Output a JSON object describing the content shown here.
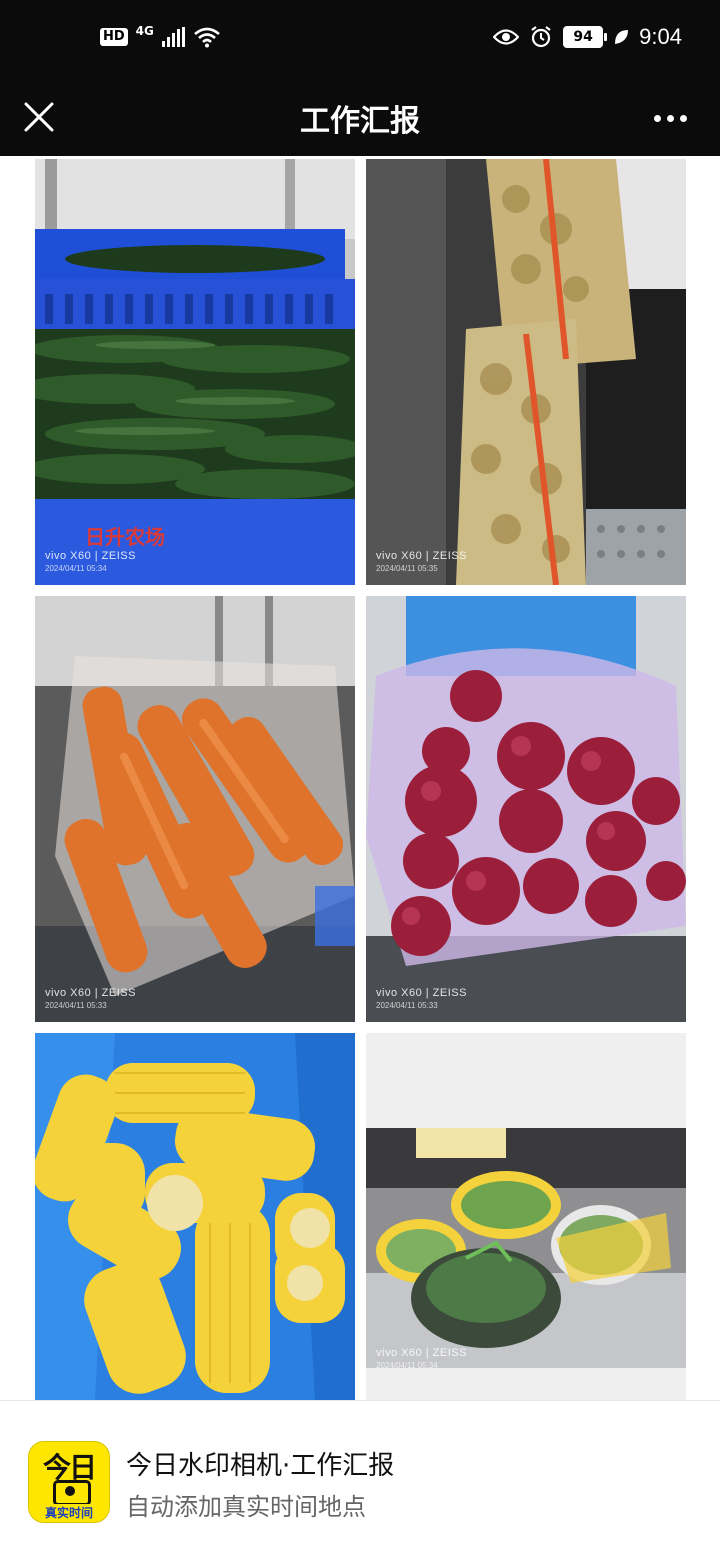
{
  "status_bar": {
    "hd_label": "HD",
    "network_label": "4G",
    "battery_level": "94",
    "time": "9:04",
    "icons": [
      "hd-icon",
      "signal-icon",
      "wifi-icon",
      "eye-icon",
      "alarm-icon",
      "battery-icon",
      "leaf-icon"
    ]
  },
  "nav": {
    "title": "工作汇报",
    "close_icon": "close-icon",
    "more_icon": "more-icon"
  },
  "photos": [
    {
      "subject": "cucumbers",
      "watermark": "vivo X60 | ZEISS",
      "date": "2024/04/11 05:34",
      "crate_text": "日升农场"
    },
    {
      "subject": "potatoes",
      "watermark": "vivo X60 | ZEISS",
      "date": "2024/04/11 05:35"
    },
    {
      "subject": "carrots",
      "watermark": "vivo X60 | ZEISS",
      "date": "2024/04/11 05:33"
    },
    {
      "subject": "red onions",
      "watermark": "vivo X60 | ZEISS",
      "date": "2024/04/11 05:33"
    },
    {
      "subject": "corn",
      "watermark": "",
      "date": ""
    },
    {
      "subject": "leafy greens",
      "watermark": "vivo X60 | ZEISS",
      "date": "2024/04/11 05:34"
    }
  ],
  "footer": {
    "app_icon_big": "今日",
    "app_icon_small": "真实时间",
    "title": "今日水印相机·工作汇报",
    "subtitle": "自动添加真实时间地点"
  },
  "colors": {
    "status_bar_bg": "#0b0b0b",
    "app_icon_yellow": "#ffe600",
    "app_icon_blue_text": "#1b3fbf"
  }
}
